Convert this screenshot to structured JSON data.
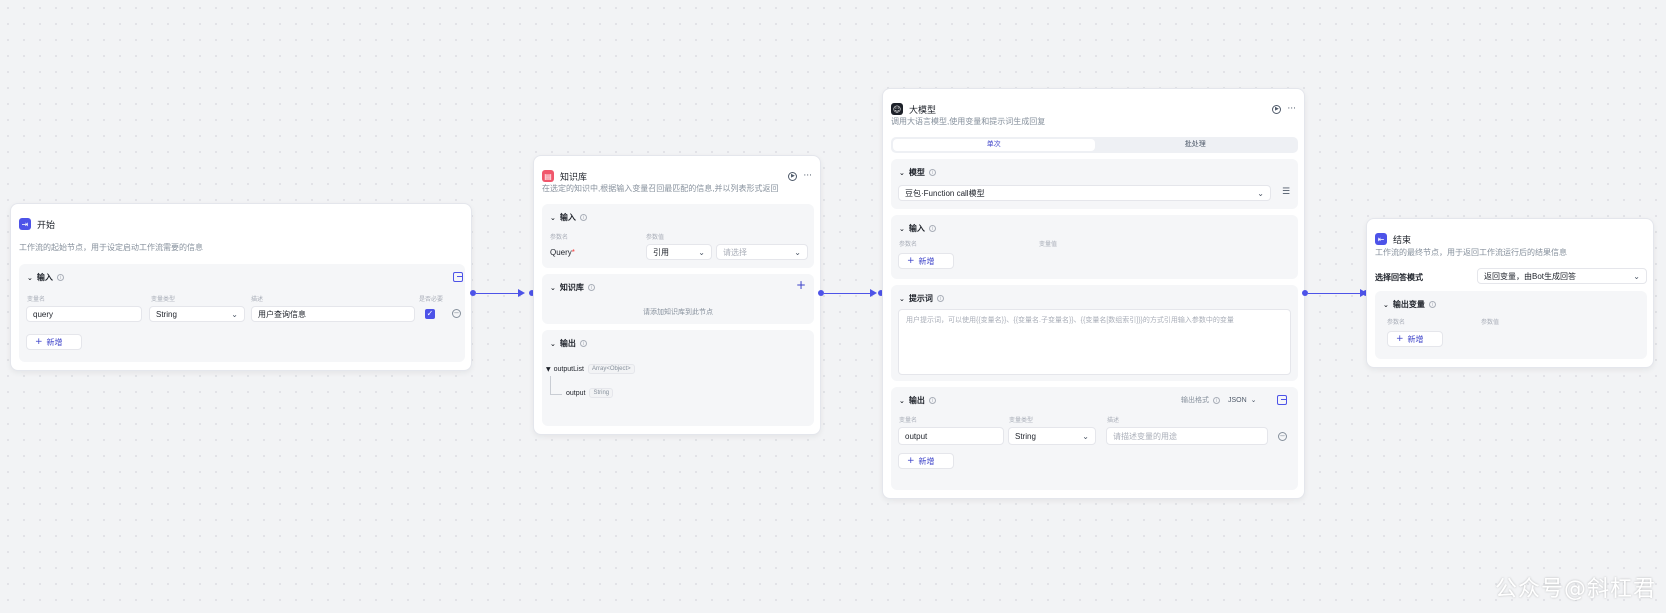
{
  "start": {
    "title": "开始",
    "desc": "工作流的起始节点，用于设定启动工作流需要的信息",
    "input_title": "输入",
    "cols": [
      "变量名",
      "变量类型",
      "描述",
      "是否必要"
    ],
    "row": {
      "name": "query",
      "type": "String",
      "desc": "用户查询信息"
    },
    "add_label": "新增"
  },
  "knowledge": {
    "title": "知识库",
    "desc": "在选定的知识中,根据输入变量召回最匹配的信息,并以列表形式返回",
    "input_title": "输入",
    "cols": [
      "参数名",
      "参数值"
    ],
    "param_name": "Query",
    "required_mark": "*",
    "ref_label": "引用",
    "select_placeholder": "请选择",
    "kb_title": "知识库",
    "kb_placeholder": "请添加知识库到此节点",
    "output_title": "输出",
    "output_list_name": "outputList",
    "output_list_type": "Array<Object>",
    "output_item_name": "output",
    "output_item_type": "String"
  },
  "llm": {
    "title": "大模型",
    "desc": "调用大语言模型,使用变量和提示词生成回复",
    "tabs": [
      "单次",
      "批处理"
    ],
    "model_title": "模型",
    "model_value": "豆包·Function call模型",
    "input_title": "输入",
    "input_cols": [
      "参数名",
      "变量值"
    ],
    "add_label": "新增",
    "prompt_title": "提示词",
    "prompt_placeholder": "用户提示词，可以使用{{变量名}}、{{变量名.子变量名}}、{{变量名[数组索引]}}的方式引用输入参数中的变量",
    "output_title": "输出",
    "output_format_label": "输出格式",
    "output_format_value": "JSON",
    "output_cols": [
      "变量名",
      "变量类型",
      "描述"
    ],
    "output_row": {
      "name": "output",
      "type": "String",
      "desc_placeholder": "请描述变量的用途"
    }
  },
  "end": {
    "title": "结束",
    "desc": "工作流的最终节点，用于返回工作流运行后的结果信息",
    "mode_label": "选择回答模式",
    "mode_value": "返回变量，由Bot生成回答",
    "output_title": "输出变量",
    "cols": [
      "参数名",
      "参数值"
    ],
    "add_label": "新增"
  },
  "watermark": "公众号@斜杠君",
  "colors": {
    "accent": "#4d53e8",
    "start_icon": "#4d53e8",
    "kb_icon": "#f0566b",
    "llm_icon": "#1d2129",
    "end_icon": "#4d53e8"
  }
}
